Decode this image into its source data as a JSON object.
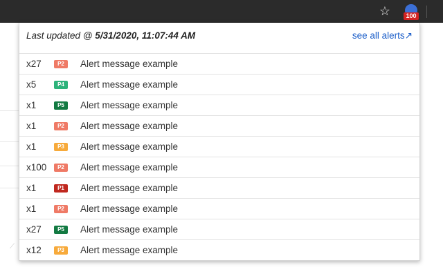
{
  "browser": {
    "star_icon": "star-icon",
    "extension_badge": "100",
    "extension_icon": "alerts-extension-icon"
  },
  "popup": {
    "last_updated_prefix": "Last updated @ ",
    "last_updated_value": "5/31/2020, 11:07:44 AM",
    "see_all_label": "see all alerts",
    "see_all_icon": "external-link-icon"
  },
  "alerts": [
    {
      "count": "x27",
      "priority": "P2",
      "message": "Alert message example"
    },
    {
      "count": "x5",
      "priority": "P4",
      "message": "Alert message example"
    },
    {
      "count": "x1",
      "priority": "P5",
      "message": "Alert message example"
    },
    {
      "count": "x1",
      "priority": "P2",
      "message": "Alert message example"
    },
    {
      "count": "x1",
      "priority": "P3",
      "message": "Alert message example"
    },
    {
      "count": "x100",
      "priority": "P2",
      "message": "Alert message example"
    },
    {
      "count": "x1",
      "priority": "P1",
      "message": "Alert message example"
    },
    {
      "count": "x1",
      "priority": "P2",
      "message": "Alert message example"
    },
    {
      "count": "x27",
      "priority": "P5",
      "message": "Alert message example"
    },
    {
      "count": "x12",
      "priority": "P3",
      "message": "Alert message example"
    }
  ],
  "priority_colors": {
    "P1": "#c0281f",
    "P2": "#ef7a66",
    "P3": "#f7aa3b",
    "P4": "#2db37b",
    "P5": "#137a42"
  }
}
